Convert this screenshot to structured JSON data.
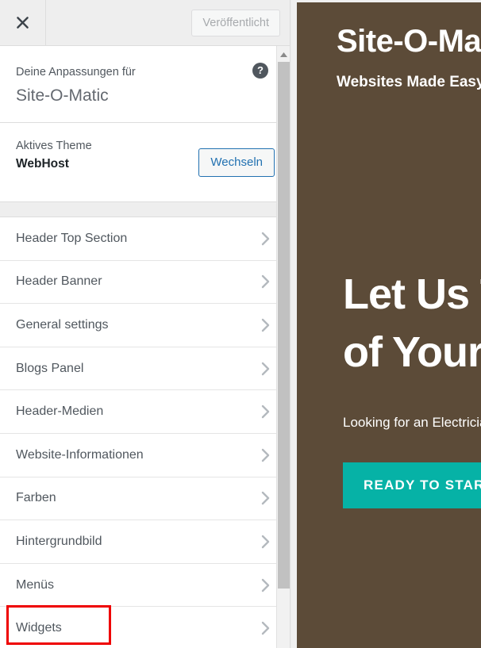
{
  "customizer": {
    "close_icon": "close-x-icon",
    "publish_button_label": "Veröffentlicht",
    "info": {
      "eyebrow": "Deine Anpassungen für",
      "site_name": "Site-O-Matic",
      "help_icon_label": "?"
    },
    "theme": {
      "eyebrow": "Aktives Theme",
      "name": "WebHost",
      "change_button_label": "Wechseln"
    },
    "sections": [
      {
        "label": "Header Top Section",
        "name": "header-top-section"
      },
      {
        "label": "Header Banner",
        "name": "header-banner"
      },
      {
        "label": "General settings",
        "name": "general-settings"
      },
      {
        "label": "Blogs Panel",
        "name": "blogs-panel"
      },
      {
        "label": "Header-Medien",
        "name": "header-medien"
      },
      {
        "label": "Website-Informationen",
        "name": "website-informationen"
      },
      {
        "label": "Farben",
        "name": "farben"
      },
      {
        "label": "Hintergrundbild",
        "name": "hintergrundbild"
      },
      {
        "label": "Menüs",
        "name": "menues"
      },
      {
        "label": "Widgets",
        "name": "widgets"
      }
    ],
    "highlighted_section": "Widgets",
    "highlight_color": "#ee0000"
  },
  "preview": {
    "site_title": "Site-O-Matic",
    "tagline": "Websites Made Easy",
    "hero_line1": "Let Us Take Care",
    "hero_line2": "of Your Website",
    "hero_sub": "Looking for an Electrician?",
    "cta_label": "READY TO START",
    "colors": {
      "background": "#5c4b38",
      "cta": "#06b2a6",
      "text": "#ffffff"
    }
  }
}
